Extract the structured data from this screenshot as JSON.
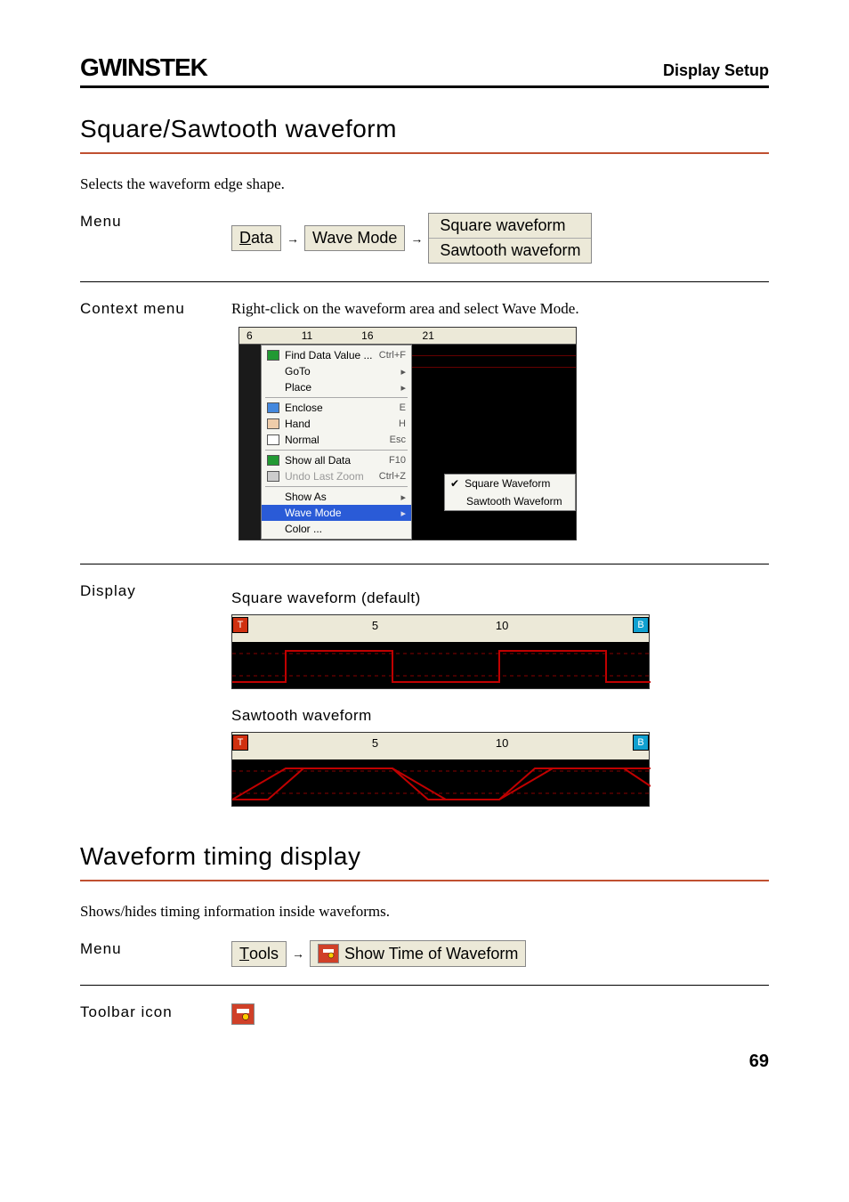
{
  "header": {
    "logo": "GWINSTEK",
    "right": "Display Setup"
  },
  "section1": {
    "title": "Square/Sawtooth waveform",
    "intro": "Selects the waveform edge shape.",
    "menu_label": "Menu",
    "menu_path": {
      "a": "Data",
      "b": "Wave Mode",
      "sub1": "Square waveform",
      "sub2": "Sawtooth waveform"
    },
    "context_label": "Context menu",
    "context_text": "Right-click on the waveform area and select Wave Mode.",
    "ctx_ruler": [
      "6",
      "11",
      "16",
      "21"
    ],
    "ctx_items": {
      "find": "Find Data Value ...",
      "find_sc": "Ctrl+F",
      "goto": "GoTo",
      "place": "Place",
      "enclose": "Enclose",
      "enclose_sc": "E",
      "hand": "Hand",
      "hand_sc": "H",
      "normal": "Normal",
      "normal_sc": "Esc",
      "showall": "Show all Data",
      "showall_sc": "F10",
      "undo": "Undo Last Zoom",
      "undo_sc": "Ctrl+Z",
      "showas": "Show As",
      "wavemode": "Wave Mode",
      "color": "Color ...",
      "sub_square": "Square Waveform",
      "sub_sawtooth": "Sawtooth Waveform"
    },
    "display_label": "Display",
    "display_square_title": "Square waveform (default)",
    "display_sawtooth_title": "Sawtooth waveform",
    "wave_ruler": {
      "n5": "5",
      "n10": "10",
      "t": "T",
      "b": "B"
    }
  },
  "section2": {
    "title": "Waveform timing display",
    "intro": "Shows/hides timing information inside waveforms.",
    "menu_label": "Menu",
    "menu_path": {
      "a": "Tools",
      "b": "Show Time of Waveform"
    },
    "toolbar_label": "Toolbar icon"
  },
  "page_number": "69"
}
